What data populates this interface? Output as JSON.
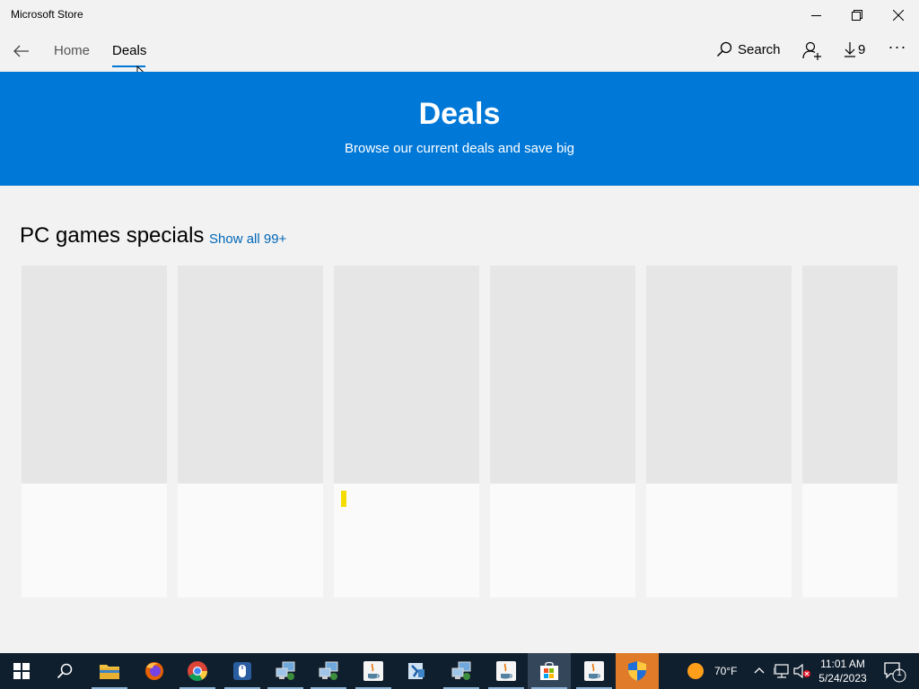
{
  "window": {
    "title": "Microsoft Store"
  },
  "nav": {
    "tabs": [
      {
        "label": "Home"
      },
      {
        "label": "Deals"
      }
    ],
    "search_label": "Search",
    "downloads_count": "9",
    "more_label": "···"
  },
  "hero": {
    "title": "Deals",
    "subtitle": "Browse our current deals and save big",
    "color": "#0078d7"
  },
  "section": {
    "title": "PC games specials",
    "show_all": "Show all 99+"
  },
  "cards_count": 6,
  "taskbar": {
    "apps": [
      "windows-start",
      "search",
      "file-explorer",
      "firefox",
      "chrome",
      "mouse-app",
      "network-app",
      "network-app-2",
      "java-app",
      "remote-desktop-app",
      "network-app-3",
      "java-app-2",
      "microsoft-store",
      "java-app-3",
      "shield-app"
    ],
    "weather": {
      "temp": "70°F"
    },
    "clock": {
      "time": "11:01 AM",
      "date": "5/24/2023"
    },
    "notification_count": "1"
  },
  "colors": {
    "accent": "#0078d7",
    "link": "#0067b8",
    "taskbar": "#101f2e"
  }
}
